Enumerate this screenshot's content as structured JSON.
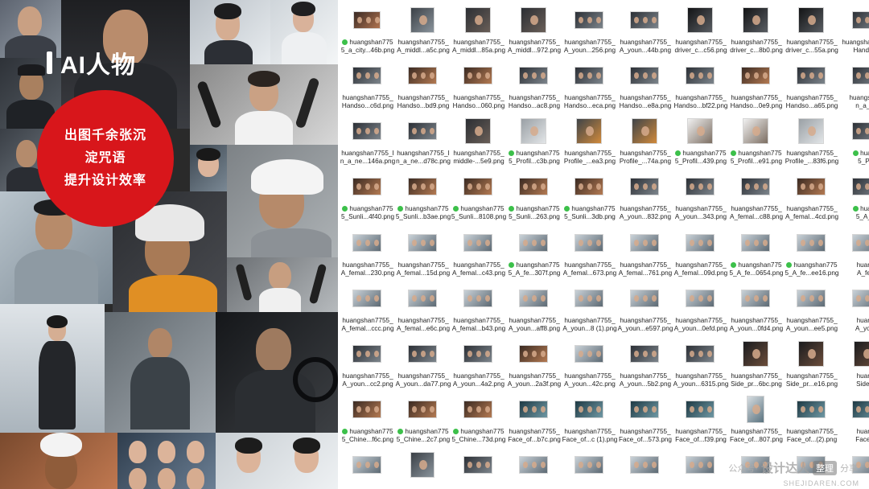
{
  "collage": {
    "title": "AI人物",
    "badge_lines": [
      "出图千余张沉",
      "淀咒语",
      "提升设计效率"
    ],
    "tiles": [
      "portrait-suit-man",
      "portrait-man-dark",
      "portrait-woman-updo",
      "portrait-woman-white-shirt",
      "portrait-driver-cap",
      "hairdresser-tools-man",
      "portrait-young-man",
      "portrait-woman-headset",
      "worker-white-helmet-profile",
      "call-center-man-headset",
      "worker-helmet-orange",
      "hairdresser-tools-man-2",
      "business-woman-hall",
      "mechanic-sitting-car",
      "driver-steering-wheel",
      "chef-portrait",
      "women-headsets-grid",
      "woman-headset-smiling"
    ]
  },
  "finder": {
    "rows": [
      [
        {
          "label": "huangshan775\n5_a_city...46b.png",
          "tag": true,
          "thumb": "city-street"
        },
        {
          "label": "huangshan7755_\nA_middl...a5c.png",
          "tag": false,
          "thumb": "portrait-single"
        },
        {
          "label": "huangshan7755_\nA_middl...85a.png",
          "tag": false,
          "thumb": "portrait-grid"
        },
        {
          "label": "huangshan7755_\nA_middl...972.png",
          "tag": false,
          "thumb": "portrait-grid"
        },
        {
          "label": "huangshan7755_\nA_youn...256.png",
          "tag": false,
          "thumb": "wide-grid"
        },
        {
          "label": "huangshan7755_\nA_youn...44b.png",
          "tag": false,
          "thumb": "wide-grid"
        },
        {
          "label": "huangshan7755_\ndriver_c...c56.png",
          "tag": false,
          "thumb": "driver"
        },
        {
          "label": "huangshan7755_\ndriver_c...8b0.png",
          "tag": false,
          "thumb": "driver"
        },
        {
          "label": "huangshan7755_\ndriver_c...55a.png",
          "tag": false,
          "thumb": "driver"
        },
        {
          "label": "huangshan7755_\nHandso...",
          "tag": false,
          "thumb": "wide-grid"
        }
      ],
      [
        {
          "label": "huangshan7755_\nHandso...c6d.png",
          "tag": false,
          "thumb": "wide-grid"
        },
        {
          "label": "huangshan7755_\nHandso...bd9.png",
          "tag": false,
          "thumb": "warm-wide"
        },
        {
          "label": "huangshan7755_\nHandso...060.png",
          "tag": false,
          "thumb": "warm-wide"
        },
        {
          "label": "huangshan7755_\nHandso...ac8.png",
          "tag": false,
          "thumb": "wide-grid"
        },
        {
          "label": "huangshan7755_\nHandso...eca.png",
          "tag": false,
          "thumb": "wide-grid"
        },
        {
          "label": "huangshan7755_\nHandso...e8a.png",
          "tag": false,
          "thumb": "wide-grid"
        },
        {
          "label": "huangshan7755_\nHandso...bf22.png",
          "tag": false,
          "thumb": "wide-grid"
        },
        {
          "label": "huangshan7755_\nHandso...0e9.png",
          "tag": false,
          "thumb": "warm-wide"
        },
        {
          "label": "huangshan7755_\nHandso...a65.png",
          "tag": false,
          "thumb": "wide-grid"
        },
        {
          "label": "huangshan7\nn_a_n...",
          "tag": false,
          "thumb": "wide-grid"
        }
      ],
      [
        {
          "label": "huangshan7755_I\nn_a_ne...146a.png",
          "tag": false,
          "thumb": "wide-grid"
        },
        {
          "label": "huangshan7755_I\nn_a_ne...d78c.png",
          "tag": false,
          "thumb": "wide-grid"
        },
        {
          "label": "huangshan7755_\nmiddle-...5e9.png",
          "tag": false,
          "thumb": "portrait-grid"
        },
        {
          "label": "huangshan775\n5_Profil...c3b.png",
          "tag": true,
          "thumb": "helmet-single"
        },
        {
          "label": "huangshan7755_\nProfile_...ea3.png",
          "tag": false,
          "thumb": "helmet-grid"
        },
        {
          "label": "huangshan7755_\nProfile_...74a.png",
          "tag": false,
          "thumb": "helmet-grid"
        },
        {
          "label": "huangshan775\n5_Profil...439.png",
          "tag": true,
          "thumb": "helmet-grid-light"
        },
        {
          "label": "huangshan775\n5_Profil...e91.png",
          "tag": true,
          "thumb": "helmet-grid-light"
        },
        {
          "label": "huangshan7755_\nProfile_...83f6.png",
          "tag": false,
          "thumb": "helmet-single"
        },
        {
          "label": "huangs\n5_Pr...",
          "tag": true,
          "thumb": "wide-grid"
        }
      ],
      [
        {
          "label": "huangshan775\n5_Sunli...4f40.png",
          "tag": true,
          "thumb": "warm-wide"
        },
        {
          "label": "huangshan775\n5_Sunli...b3ae.png",
          "tag": true,
          "thumb": "warm-wide"
        },
        {
          "label": "huangshan775\n5_Sunli...8108.png",
          "tag": true,
          "thumb": "warm-wide"
        },
        {
          "label": "huangshan775\n5_Sunli...263.png",
          "tag": true,
          "thumb": "warm-wide"
        },
        {
          "label": "huangshan775\n5_Sunli...3db.png",
          "tag": true,
          "thumb": "warm-wide"
        },
        {
          "label": "huangshan7755_\nA_youn...832.png",
          "tag": false,
          "thumb": "wide-grid"
        },
        {
          "label": "huangshan7755_\nA_youn...343.png",
          "tag": false,
          "thumb": "wide-grid"
        },
        {
          "label": "huangshan7755_\nA_femal...c88.png",
          "tag": false,
          "thumb": "wide-grid"
        },
        {
          "label": "huangshan7755_\nA_femal...4cd.png",
          "tag": false,
          "thumb": "warm-wide"
        },
        {
          "label": "huangs\n5_A_f...",
          "tag": true,
          "thumb": "wide-grid"
        }
      ],
      [
        {
          "label": "huangshan7755_\nA_femal...230.png",
          "tag": false,
          "thumb": "light-wide"
        },
        {
          "label": "huangshan7755_\nA_femal...15d.png",
          "tag": false,
          "thumb": "light-wide"
        },
        {
          "label": "huangshan7755_\nA_femal...c43.png",
          "tag": false,
          "thumb": "light-wide"
        },
        {
          "label": "huangshan775\n5_A_fe...307f.png",
          "tag": true,
          "thumb": "light-wide"
        },
        {
          "label": "huangshan7755_\nA_femal...673.png",
          "tag": false,
          "thumb": "light-wide"
        },
        {
          "label": "huangshan7755_\nA_femal...761.png",
          "tag": false,
          "thumb": "light-wide"
        },
        {
          "label": "huangshan7755_\nA_femal...09d.png",
          "tag": false,
          "thumb": "light-wide"
        },
        {
          "label": "huangshan775\n5_A_fe...0654.png",
          "tag": true,
          "thumb": "light-wide"
        },
        {
          "label": "huangshan775\n5_A_fe...ee16.png",
          "tag": true,
          "thumb": "light-wide"
        },
        {
          "label": "huangs\nA_fer...",
          "tag": false,
          "thumb": "light-wide"
        }
      ],
      [
        {
          "label": "huangshan7755_\nA_femal...ccc.png",
          "tag": false,
          "thumb": "light-wide"
        },
        {
          "label": "huangshan7755_\nA_femal...e6c.png",
          "tag": false,
          "thumb": "light-wide"
        },
        {
          "label": "huangshan7755_\nA_femal...b43.png",
          "tag": false,
          "thumb": "light-wide"
        },
        {
          "label": "huangshan7755_\nA_youn...aff8.png",
          "tag": false,
          "thumb": "light-wide"
        },
        {
          "label": "huangshan7755_\nA_youn...8 (1).png",
          "tag": false,
          "thumb": "light-wide"
        },
        {
          "label": "huangshan7755_\nA_youn...e597.png",
          "tag": false,
          "thumb": "light-wide"
        },
        {
          "label": "huangshan7755_\nA_youn...0efd.png",
          "tag": false,
          "thumb": "light-wide"
        },
        {
          "label": "huangshan7755_\nA_youn...0fd4.png",
          "tag": false,
          "thumb": "light-wide"
        },
        {
          "label": "huangshan7755_\nA_youn...ee5.png",
          "tag": false,
          "thumb": "light-wide"
        },
        {
          "label": "huangs\nA_you...",
          "tag": false,
          "thumb": "light-wide"
        }
      ],
      [
        {
          "label": "huangshan7755_\nA_youn...cc2.png",
          "tag": false,
          "thumb": "wide-grid"
        },
        {
          "label": "huangshan7755_\nA_youn...da77.png",
          "tag": false,
          "thumb": "wide-grid"
        },
        {
          "label": "huangshan7755_\nA_youn...4a2.png",
          "tag": false,
          "thumb": "wide-grid"
        },
        {
          "label": "huangshan7755_\nA_youn...2a3f.png",
          "tag": false,
          "thumb": "warm-wide"
        },
        {
          "label": "huangshan7755_\nA_youn...42c.png",
          "tag": false,
          "thumb": "light-wide"
        },
        {
          "label": "huangshan7755_\nA_youn...5b2.png",
          "tag": false,
          "thumb": "wide-grid"
        },
        {
          "label": "huangshan7755_\nA_youn...6315.png",
          "tag": false,
          "thumb": "wide-grid"
        },
        {
          "label": "huangshan7755_\nSide_pr...6bc.png",
          "tag": false,
          "thumb": "side-grid"
        },
        {
          "label": "huangshan7755_\nSide_pr...e16.png",
          "tag": false,
          "thumb": "side-grid"
        },
        {
          "label": "huangs\nSide_...",
          "tag": false,
          "thumb": "side-grid"
        }
      ],
      [
        {
          "label": "huangshan775\n5_Chine...f6c.png",
          "tag": true,
          "thumb": "warm-wide"
        },
        {
          "label": "huangshan775\n5_Chine...2c7.png",
          "tag": true,
          "thumb": "warm-wide"
        },
        {
          "label": "huangshan775\n5_Chine...73d.png",
          "tag": true,
          "thumb": "warm-wide"
        },
        {
          "label": "huangshan7755_\nFace_of...b7c.png",
          "tag": false,
          "thumb": "teal-wide"
        },
        {
          "label": "huangshan7755_\nFace_of...c (1).png",
          "tag": false,
          "thumb": "teal-wide"
        },
        {
          "label": "huangshan7755_\nFace_of...573.png",
          "tag": false,
          "thumb": "teal-wide"
        },
        {
          "label": "huangshan7755_\nFace_of...f39.png",
          "tag": false,
          "thumb": "teal-wide"
        },
        {
          "label": "huangshan7755_\nFace_of...807.png",
          "tag": false,
          "thumb": "teal-tall"
        },
        {
          "label": "huangshan7755_\nFace_of...(2).png",
          "tag": false,
          "thumb": "teal-wide"
        },
        {
          "label": "huangs\nFace_...",
          "tag": false,
          "thumb": "teal-wide"
        }
      ],
      [
        {
          "label": "",
          "tag": false,
          "thumb": "light-wide"
        },
        {
          "label": "",
          "tag": false,
          "thumb": "portrait-single"
        },
        {
          "label": "",
          "tag": false,
          "thumb": "wide-grid"
        },
        {
          "label": "",
          "tag": false,
          "thumb": "light-wide"
        },
        {
          "label": "",
          "tag": false,
          "thumb": "light-wide"
        },
        {
          "label": "",
          "tag": false,
          "thumb": "light-wide"
        },
        {
          "label": "",
          "tag": false,
          "thumb": "light-wide"
        },
        {
          "label": "",
          "tag": false,
          "thumb": "light-wide"
        },
        {
          "label": "",
          "tag": false,
          "thumb": "light-wide"
        },
        {
          "label": "",
          "tag": false,
          "thumb": "light-wide"
        }
      ]
    ]
  },
  "watermark": {
    "prefix": "公众号·",
    "name": "设计达人",
    "pill": "整理",
    "suffix": "分享",
    "url": "SHEJIDAREN.COM"
  },
  "colors": {
    "accent_red": "#d8161b",
    "finder_tag_green": "#3cc04a"
  }
}
